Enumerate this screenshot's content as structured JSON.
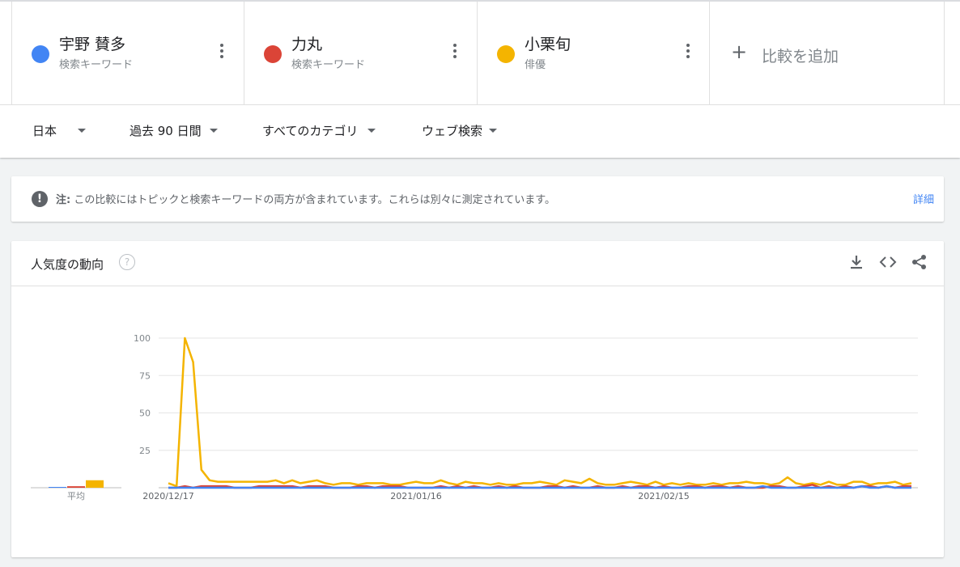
{
  "terms": [
    {
      "name": "宇野 賛多",
      "type": "検索キーワード",
      "color": "#4285f4"
    },
    {
      "name": "力丸",
      "type": "検索キーワード",
      "color": "#db4437"
    },
    {
      "name": "小栗旬",
      "type": "俳優",
      "color": "#f4b400"
    }
  ],
  "add_compare": "比較を追加",
  "filters": {
    "region": "日本",
    "period": "過去 90 日間",
    "category": "すべてのカテゴリ",
    "search_type": "ウェブ検索"
  },
  "note": {
    "prefix": "注:",
    "text": "この比較にはトピックと検索キーワードの両方が含まれています。これらは別々に測定されています。",
    "link": "詳細"
  },
  "card": {
    "title": "人気度の動向",
    "help_icon": "help-icon",
    "icons": [
      "download-icon",
      "embed-icon",
      "share-icon"
    ]
  },
  "chart_data": {
    "type": "line",
    "ylim": [
      0,
      100
    ],
    "yticks": [
      25,
      50,
      75,
      100
    ],
    "x_labels": [
      "2020/12/17",
      "2021/01/16",
      "2021/02/15"
    ],
    "average_label": "平均",
    "averages": [
      {
        "name": "宇野 賛多",
        "value": 0
      },
      {
        "name": "力丸",
        "value": 1
      },
      {
        "name": "小栗旬",
        "value": 5
      }
    ],
    "series": [
      {
        "name": "小栗旬",
        "color": "#f4b400",
        "values": [
          3,
          1,
          100,
          84,
          12,
          5,
          4,
          4,
          4,
          4,
          4,
          4,
          4,
          5,
          3,
          5,
          3,
          4,
          5,
          3,
          2,
          3,
          3,
          2,
          3,
          3,
          3,
          2,
          2,
          3,
          4,
          3,
          3,
          5,
          3,
          2,
          4,
          3,
          3,
          2,
          3,
          2,
          2,
          3,
          3,
          4,
          3,
          2,
          5,
          4,
          3,
          6,
          3,
          2,
          2,
          3,
          4,
          3,
          2,
          4,
          2,
          3,
          2,
          3,
          2,
          2,
          3,
          2,
          3,
          3,
          4,
          3,
          3,
          2,
          3,
          7,
          3,
          2,
          3,
          2,
          4,
          2,
          2,
          4,
          4,
          2,
          3,
          3,
          4,
          2,
          3
        ]
      },
      {
        "name": "力丸",
        "color": "#db4437",
        "values": [
          0,
          0,
          1,
          0,
          1,
          1,
          1,
          1,
          0,
          0,
          0,
          1,
          1,
          1,
          1,
          1,
          0,
          1,
          1,
          1,
          0,
          0,
          0,
          1,
          1,
          0,
          1,
          1,
          1,
          0,
          0,
          0,
          0,
          1,
          0,
          1,
          0,
          1,
          0,
          0,
          1,
          0,
          1,
          0,
          0,
          0,
          1,
          1,
          0,
          1,
          0,
          0,
          1,
          0,
          0,
          1,
          0,
          1,
          1,
          0,
          1,
          0,
          0,
          1,
          1,
          0,
          1,
          1,
          0,
          1,
          0,
          0,
          0,
          1,
          1,
          0,
          0,
          1,
          2,
          0,
          1,
          0,
          1,
          0,
          1,
          1,
          0,
          1,
          0,
          1,
          1
        ]
      },
      {
        "name": "宇野 賛多",
        "color": "#4285f4",
        "values": [
          0,
          0,
          0,
          0,
          0,
          0,
          0,
          0,
          0,
          0,
          0,
          0,
          0,
          0,
          0,
          0,
          0,
          0,
          0,
          0,
          0,
          0,
          0,
          0,
          0,
          0,
          0,
          0,
          0,
          0,
          0,
          0,
          0,
          0,
          0,
          0,
          0,
          0,
          0,
          0,
          0,
          0,
          0,
          0,
          0,
          0,
          0,
          0,
          0,
          0,
          0,
          0,
          0,
          0,
          0,
          0,
          0,
          0,
          0,
          0,
          0,
          0,
          0,
          0,
          0,
          0,
          0,
          0,
          0,
          0,
          0,
          0,
          1,
          0,
          0,
          0,
          0,
          0,
          0,
          0,
          0,
          0,
          0,
          0,
          1,
          0,
          0,
          1,
          0,
          0,
          0
        ]
      }
    ],
    "x_label_index": [
      0,
      30,
      60
    ]
  }
}
